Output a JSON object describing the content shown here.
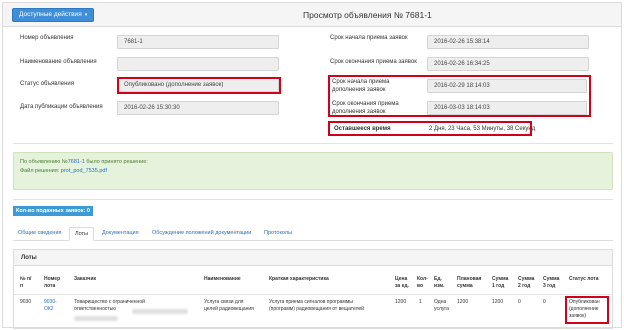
{
  "header": {
    "actions_label": "Доступные действия",
    "caret": "▾",
    "title": "Просмотр объявления № 7681-1"
  },
  "left": {
    "number_label": "Номер объявления",
    "number_value": "7681-1",
    "name_label": "Наименование объявления",
    "name_value": "",
    "status_label": "Статус объявления",
    "status_value": "Опубликовано (дополнение заявок)",
    "pubdate_label": "Дата публикации объявления",
    "pubdate_value": "2016-02-26 15:30:30"
  },
  "right": {
    "start_label": "Срок начала приема заявок",
    "start_value": "2016-02-26 15:38:14",
    "end_label": "Срок окончания приема заявок",
    "end_value": "2016-02-26 16:34:25",
    "add_start_label_1": "Срок начала приема",
    "add_start_label_2": "дополнения заявок",
    "add_start_value": "2016-02-29 18:14:03",
    "add_end_label_1": "Срок окончания приема",
    "add_end_label_2": "дополнения заявок",
    "add_end_value": "2016-03-03 18:14:03",
    "remaining_label": "Оставшееся время",
    "remaining_value": "2 Дня, 23 Часа, 53 Минуты, 38 Секунд"
  },
  "notice": {
    "line1_prefix": "По объявлению №",
    "line1_link": "7681-1",
    "line1_suffix": " было принято решение:",
    "line2_prefix": "Файл решения: ",
    "line2_link": "prot_pod_7535.pdf"
  },
  "bids_badge": "Кол-во поданных заявок: 0",
  "tabs": [
    "Общие сведения",
    "Лоты",
    "Документация",
    "Обсуждение положений документации",
    "Протоколы"
  ],
  "lots": {
    "title": "Лоты",
    "headers": {
      "num_1": "№ п/",
      "num_2": "п",
      "lotno_1": "Номер",
      "lotno_2": "лота",
      "customer": "Заказчик",
      "name": "Наименование",
      "char": "Краткая характеристика",
      "price_1": "Цена",
      "price_2": "за ед.",
      "qty_1": "Кол-",
      "qty_2": "во",
      "unit_1": "Ед.",
      "unit_2": "изм.",
      "plan_1": "Плановая",
      "plan_2": "сумма",
      "y1_1": "Сумма",
      "y1_2": "1 год",
      "y2_1": "Сумма",
      "y2_2": "2 год",
      "y3_1": "Сумма",
      "y3_2": "3 год",
      "status": "Статус лота"
    },
    "row": {
      "num": "9030",
      "lotno_1": "9030-",
      "lotno_2": "ОК2",
      "customer_1": "Товарищество с ограниченной",
      "customer_2": "ответственностью",
      "name_1": "Услуга связи для",
      "name_2": "целей радиовещания",
      "char_1": "Услуга приема сигналов программы",
      "char_2": "(программ) радиовещания от вещателей",
      "price": "1200",
      "qty": "1",
      "unit_1": "Одна",
      "unit_2": "услуга",
      "plan": "1200",
      "y1": "1200",
      "y2": "0",
      "y3": "0",
      "status_1": "Опубликован",
      "status_2": "(дополнение",
      "status_3": "заявок)"
    }
  },
  "colors": {
    "accent": "#3f8fd8",
    "highlight": "#d0021b",
    "notice_bg": "#e6f3dc",
    "badge": "#3c9bd6"
  }
}
